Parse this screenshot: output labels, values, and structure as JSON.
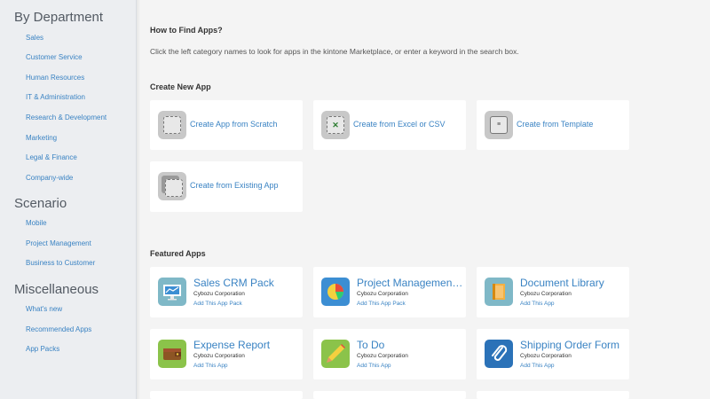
{
  "sidebar": {
    "sections": [
      {
        "title": "By Department",
        "items": [
          "Sales",
          "Customer Service",
          "Human Resources",
          "IT & Administration",
          "Research & Development",
          "Marketing",
          "Legal & Finance",
          "Company-wide"
        ]
      },
      {
        "title": "Scenario",
        "items": [
          "Mobile",
          "Project Management",
          "Business to Customer"
        ]
      },
      {
        "title": "Miscellaneous",
        "items": [
          "What's new",
          "Recommended Apps",
          "App Packs"
        ]
      }
    ]
  },
  "main": {
    "find_heading": "How to Find Apps?",
    "find_desc": "Click the left category names to look for apps in the kintone Marketplace, or enter a keyword in the search box.",
    "create_heading": "Create New App",
    "create_cards": [
      {
        "label": "Create App from Scratch",
        "icon": "scratch-icon"
      },
      {
        "label": "Create from Excel or CSV",
        "icon": "excel-icon"
      },
      {
        "label": "Create from Template",
        "icon": "template-icon"
      },
      {
        "label": "Create from Existing App",
        "icon": "existing-app-icon"
      }
    ],
    "featured_heading": "Featured Apps",
    "featured": [
      {
        "title": "Sales CRM Pack",
        "company": "Cybozu Corporation",
        "action": "Add This App Pack",
        "icon": "monitor-chart-icon",
        "color": "#7fb8c7"
      },
      {
        "title": "Project Management...",
        "company": "Cybozu Corporation",
        "action": "Add This App Pack",
        "icon": "pie-chart-icon",
        "color": "#3c8ed3"
      },
      {
        "title": "Document Library",
        "company": "Cybozu Corporation",
        "action": "Add This App",
        "icon": "folder-icon",
        "color": "#7fb8c7"
      },
      {
        "title": "Expense Report",
        "company": "Cybozu Corporation",
        "action": "Add This App",
        "icon": "wallet-icon",
        "color": "#8bc34a"
      },
      {
        "title": "To Do",
        "company": "Cybozu Corporation",
        "action": "Add This App",
        "icon": "pencil-icon",
        "color": "#8bc34a"
      },
      {
        "title": "Shipping Order Form",
        "company": "Cybozu Corporation",
        "action": "Add This App",
        "icon": "paperclip-icon",
        "color": "#2b72b8"
      }
    ]
  }
}
